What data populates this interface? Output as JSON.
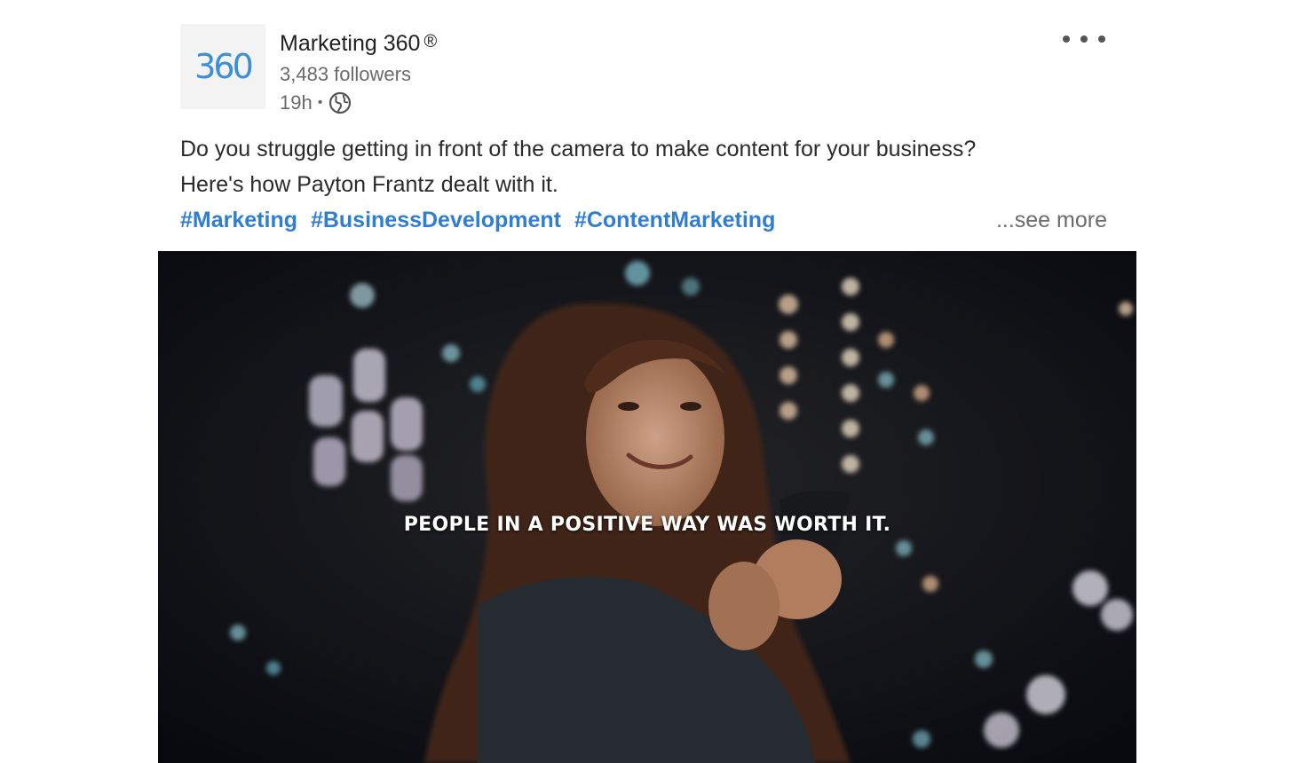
{
  "post": {
    "author": {
      "logo_text": "360",
      "name": "Marketing 360",
      "registered_mark": "®",
      "followers": "3,483 followers",
      "time": "19h",
      "separator": "•",
      "visibility_icon": "globe-icon"
    },
    "menu_icon": "more-horizontal-icon",
    "text_line1": "Do you struggle getting in front of the camera to make content for your business?",
    "text_line2": "Here's how Payton Frantz dealt with it.",
    "hashtags": [
      "#Marketing",
      "#BusinessDevelopment",
      "#ContentMarketing"
    ],
    "see_more": "...see more",
    "media": {
      "caption": "PEOPLE IN A POSITIVE WAY WAS WORTH IT."
    },
    "colors": {
      "hashtag": "#2f7ed1",
      "logo": "#3a8fd6",
      "text": "#2b2b2b",
      "secondary": "#6b6b6b"
    }
  }
}
